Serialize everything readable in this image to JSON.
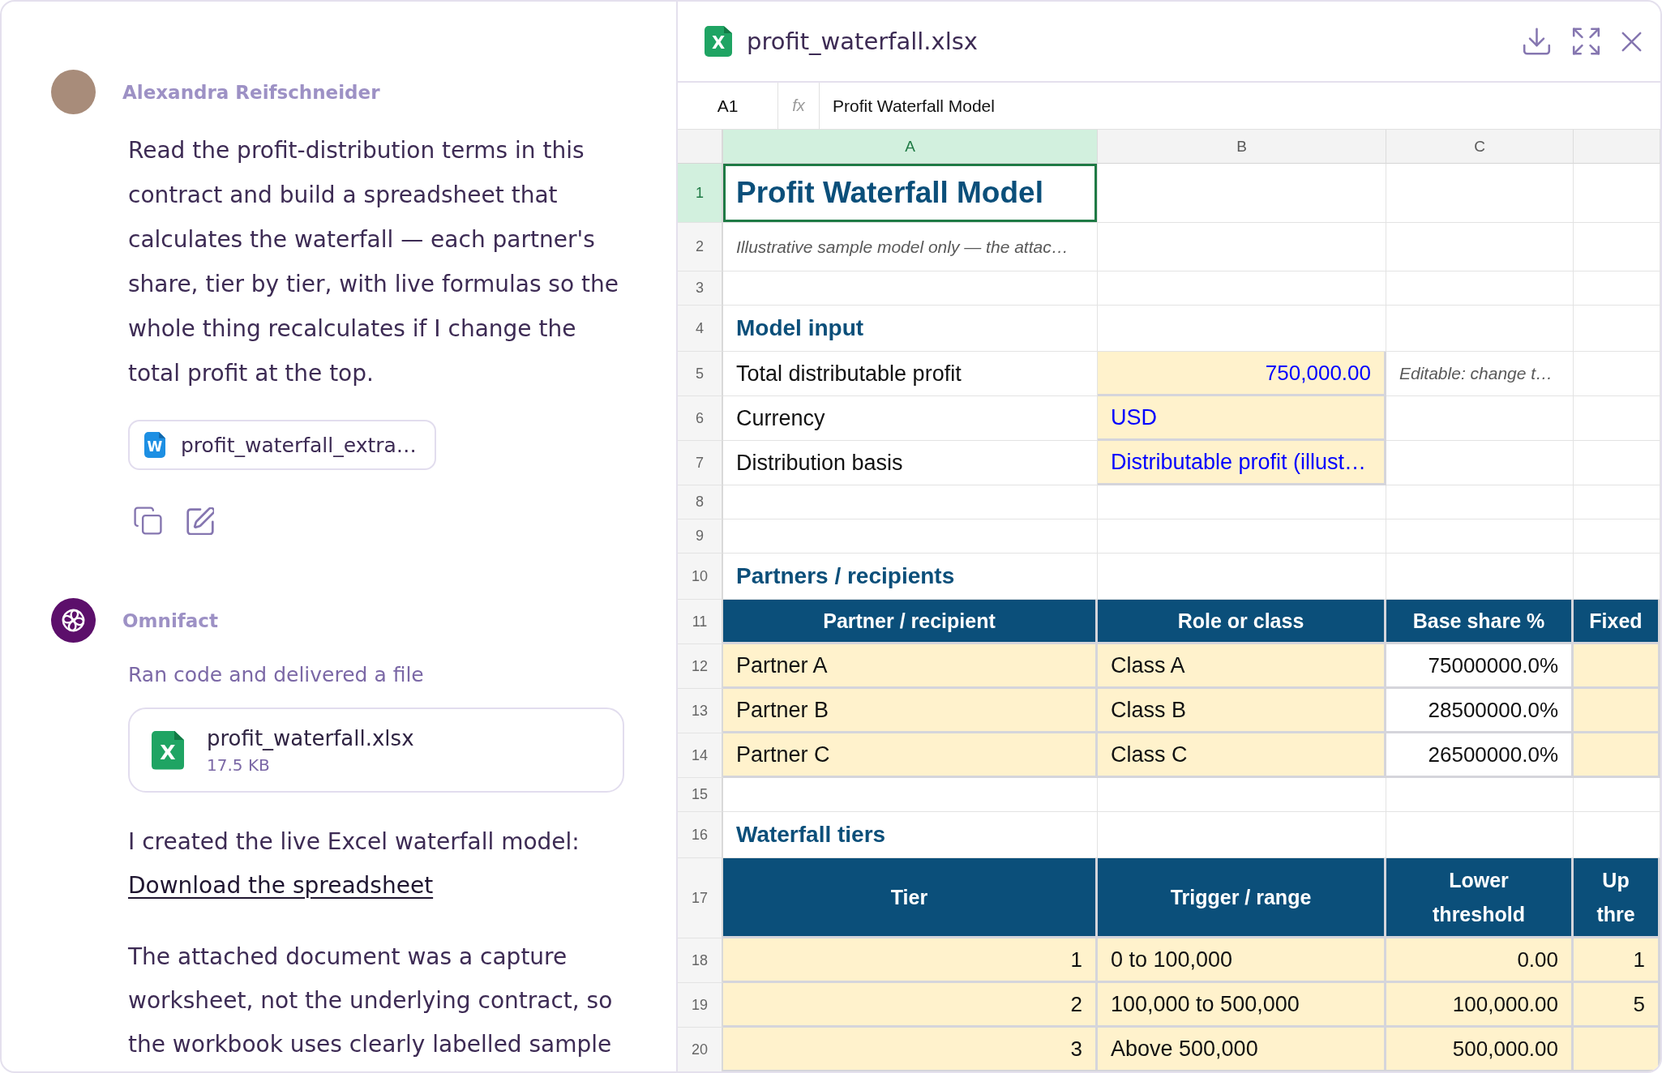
{
  "conversation": {
    "user_message": {
      "author": "Alexandra Reifschneider",
      "text": "Read the profit-distribution terms in this contract and build a spreadsheet that calculates the waterfall — each partner's share, tier by tier, with live formulas so the whole thing recalculates if I change the total profit at the top.",
      "attachment": {
        "kind": "document",
        "icon": "W",
        "name": "profit_waterfall_extra…"
      }
    },
    "assistant_message": {
      "author": "Omnifact",
      "status": "Ran code and delivered a file",
      "file": {
        "kind": "spreadsheet",
        "icon": "X",
        "name": "profit_waterfall.xlsx",
        "size": "17.5 KB"
      },
      "paragraphs": [
        {
          "text": "I created the live Excel waterfall model:",
          "link": "Download the spreadsheet"
        },
        {
          "text": "The attached document was a capture worksheet, not the underlying contract, so the workbook uses clearly labelled sample"
        }
      ]
    }
  },
  "viewer": {
    "kind": "spreadsheet",
    "icon": "X",
    "title": "profit_waterfall.xlsx",
    "formula_bar": {
      "cell_ref": "A1",
      "function_label": "fx",
      "formula": "Profit Waterfall Model"
    },
    "sheet": {
      "columns": [
        {
          "label": "A",
          "selected": true
        },
        {
          "label": "B",
          "selected": false
        },
        {
          "label": "C",
          "selected": false
        }
      ],
      "rows": [
        {
          "number": "1",
          "selected": true,
          "cells": [
            {
              "kind": "title",
              "text": "Profit Waterfall Model"
            }
          ]
        },
        {
          "number": "2",
          "selected": false,
          "cells": [
            {
              "kind": "note",
              "text": "Illustrative sample model only — the attac…"
            }
          ]
        },
        {
          "number": "3",
          "selected": false
        },
        {
          "number": "4",
          "selected": false,
          "cells": [
            {
              "kind": "section",
              "text": "Model input"
            }
          ]
        },
        {
          "number": "5",
          "selected": false,
          "cells": [
            {
              "kind": "label",
              "text": "Total distributable profit"
            },
            {
              "kind": "input_number",
              "text": "750,000.00"
            },
            {
              "kind": "note",
              "text": "Editable: change t…"
            }
          ]
        },
        {
          "number": "6",
          "selected": false,
          "cells": [
            {
              "kind": "label",
              "text": "Currency"
            },
            {
              "kind": "input",
              "text": "USD"
            }
          ]
        },
        {
          "number": "7",
          "selected": false,
          "cells": [
            {
              "kind": "label",
              "text": "Distribution basis"
            },
            {
              "kind": "input",
              "text": "Distributable profit (illust…"
            }
          ]
        },
        {
          "number": "8",
          "selected": false
        },
        {
          "number": "9",
          "selected": false
        },
        {
          "number": "10",
          "selected": false,
          "cells": [
            {
              "kind": "section",
              "text": "Partners / recipients"
            }
          ]
        },
        {
          "number": "11",
          "selected": false,
          "cells": [
            {
              "kind": "header",
              "text": "Partner / recipient"
            },
            {
              "kind": "header",
              "text": "Role or class"
            },
            {
              "kind": "header",
              "text": "Base share %"
            },
            {
              "kind": "header",
              "text": "Fixed"
            }
          ]
        },
        {
          "number": "12",
          "selected": false,
          "cells": [
            {
              "kind": "entry",
              "text": "Partner A"
            },
            {
              "kind": "entry",
              "text": "Class A"
            },
            {
              "kind": "value",
              "text": "75000000.0%"
            },
            {
              "kind": "entry"
            }
          ]
        },
        {
          "number": "13",
          "selected": false,
          "cells": [
            {
              "kind": "entry",
              "text": "Partner B"
            },
            {
              "kind": "entry",
              "text": "Class B"
            },
            {
              "kind": "value",
              "text": "28500000.0%"
            },
            {
              "kind": "entry"
            }
          ]
        },
        {
          "number": "14",
          "selected": false,
          "cells": [
            {
              "kind": "entry",
              "text": "Partner C"
            },
            {
              "kind": "entry",
              "text": "Class C"
            },
            {
              "kind": "value",
              "text": "26500000.0%"
            },
            {
              "kind": "entry"
            }
          ]
        },
        {
          "number": "15",
          "selected": false
        },
        {
          "number": "16",
          "selected": false,
          "cells": [
            {
              "kind": "section",
              "text": "Waterfall tiers"
            }
          ]
        },
        {
          "number": "17",
          "selected": false,
          "cells": [
            {
              "kind": "header",
              "text": "Tier"
            },
            {
              "kind": "header",
              "text": "Trigger / range"
            },
            {
              "kind": "header",
              "text": "Lower threshold",
              "wrap": true
            },
            {
              "kind": "header",
              "text": "Up thre",
              "wrap": true
            }
          ]
        },
        {
          "number": "18",
          "selected": false,
          "cells": [
            {
              "kind": "entry_number",
              "text": "1"
            },
            {
              "kind": "entry",
              "text": "0 to 100,000"
            },
            {
              "kind": "entry_number",
              "text": "0.00"
            },
            {
              "kind": "entry_number",
              "text": "1"
            }
          ]
        },
        {
          "number": "19",
          "selected": false,
          "cells": [
            {
              "kind": "entry_number",
              "text": "2"
            },
            {
              "kind": "entry",
              "text": "100,000 to 500,000"
            },
            {
              "kind": "entry_number",
              "text": "100,000.00"
            },
            {
              "kind": "entry_number",
              "text": "5"
            }
          ]
        },
        {
          "number": "20",
          "selected": false,
          "cells": [
            {
              "kind": "entry_number",
              "text": "3"
            },
            {
              "kind": "entry",
              "text": "Above 500,000"
            },
            {
              "kind": "entry_number",
              "text": "500,000.00"
            },
            {
              "kind": "entry"
            }
          ]
        }
      ]
    }
  }
}
